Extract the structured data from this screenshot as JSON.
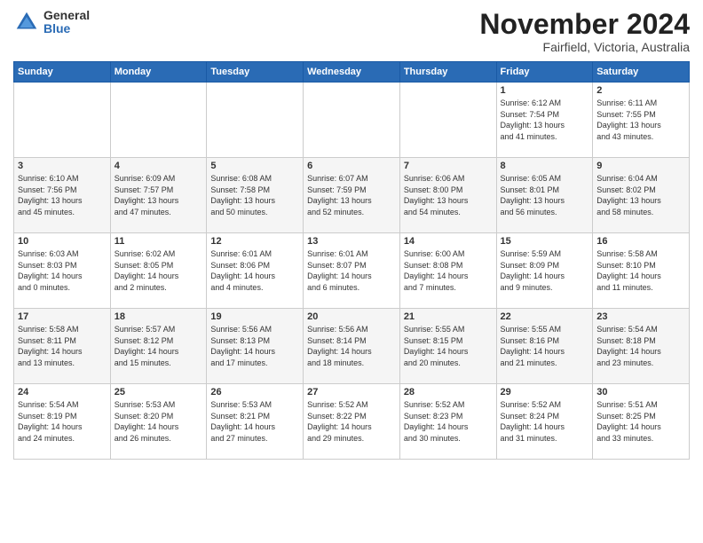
{
  "logo": {
    "general": "General",
    "blue": "Blue"
  },
  "title": "November 2024",
  "subtitle": "Fairfield, Victoria, Australia",
  "days_of_week": [
    "Sunday",
    "Monday",
    "Tuesday",
    "Wednesday",
    "Thursday",
    "Friday",
    "Saturday"
  ],
  "weeks": [
    [
      {
        "day": "",
        "info": ""
      },
      {
        "day": "",
        "info": ""
      },
      {
        "day": "",
        "info": ""
      },
      {
        "day": "",
        "info": ""
      },
      {
        "day": "",
        "info": ""
      },
      {
        "day": "1",
        "info": "Sunrise: 6:12 AM\nSunset: 7:54 PM\nDaylight: 13 hours\nand 41 minutes."
      },
      {
        "day": "2",
        "info": "Sunrise: 6:11 AM\nSunset: 7:55 PM\nDaylight: 13 hours\nand 43 minutes."
      }
    ],
    [
      {
        "day": "3",
        "info": "Sunrise: 6:10 AM\nSunset: 7:56 PM\nDaylight: 13 hours\nand 45 minutes."
      },
      {
        "day": "4",
        "info": "Sunrise: 6:09 AM\nSunset: 7:57 PM\nDaylight: 13 hours\nand 47 minutes."
      },
      {
        "day": "5",
        "info": "Sunrise: 6:08 AM\nSunset: 7:58 PM\nDaylight: 13 hours\nand 50 minutes."
      },
      {
        "day": "6",
        "info": "Sunrise: 6:07 AM\nSunset: 7:59 PM\nDaylight: 13 hours\nand 52 minutes."
      },
      {
        "day": "7",
        "info": "Sunrise: 6:06 AM\nSunset: 8:00 PM\nDaylight: 13 hours\nand 54 minutes."
      },
      {
        "day": "8",
        "info": "Sunrise: 6:05 AM\nSunset: 8:01 PM\nDaylight: 13 hours\nand 56 minutes."
      },
      {
        "day": "9",
        "info": "Sunrise: 6:04 AM\nSunset: 8:02 PM\nDaylight: 13 hours\nand 58 minutes."
      }
    ],
    [
      {
        "day": "10",
        "info": "Sunrise: 6:03 AM\nSunset: 8:03 PM\nDaylight: 14 hours\nand 0 minutes."
      },
      {
        "day": "11",
        "info": "Sunrise: 6:02 AM\nSunset: 8:05 PM\nDaylight: 14 hours\nand 2 minutes."
      },
      {
        "day": "12",
        "info": "Sunrise: 6:01 AM\nSunset: 8:06 PM\nDaylight: 14 hours\nand 4 minutes."
      },
      {
        "day": "13",
        "info": "Sunrise: 6:01 AM\nSunset: 8:07 PM\nDaylight: 14 hours\nand 6 minutes."
      },
      {
        "day": "14",
        "info": "Sunrise: 6:00 AM\nSunset: 8:08 PM\nDaylight: 14 hours\nand 7 minutes."
      },
      {
        "day": "15",
        "info": "Sunrise: 5:59 AM\nSunset: 8:09 PM\nDaylight: 14 hours\nand 9 minutes."
      },
      {
        "day": "16",
        "info": "Sunrise: 5:58 AM\nSunset: 8:10 PM\nDaylight: 14 hours\nand 11 minutes."
      }
    ],
    [
      {
        "day": "17",
        "info": "Sunrise: 5:58 AM\nSunset: 8:11 PM\nDaylight: 14 hours\nand 13 minutes."
      },
      {
        "day": "18",
        "info": "Sunrise: 5:57 AM\nSunset: 8:12 PM\nDaylight: 14 hours\nand 15 minutes."
      },
      {
        "day": "19",
        "info": "Sunrise: 5:56 AM\nSunset: 8:13 PM\nDaylight: 14 hours\nand 17 minutes."
      },
      {
        "day": "20",
        "info": "Sunrise: 5:56 AM\nSunset: 8:14 PM\nDaylight: 14 hours\nand 18 minutes."
      },
      {
        "day": "21",
        "info": "Sunrise: 5:55 AM\nSunset: 8:15 PM\nDaylight: 14 hours\nand 20 minutes."
      },
      {
        "day": "22",
        "info": "Sunrise: 5:55 AM\nSunset: 8:16 PM\nDaylight: 14 hours\nand 21 minutes."
      },
      {
        "day": "23",
        "info": "Sunrise: 5:54 AM\nSunset: 8:18 PM\nDaylight: 14 hours\nand 23 minutes."
      }
    ],
    [
      {
        "day": "24",
        "info": "Sunrise: 5:54 AM\nSunset: 8:19 PM\nDaylight: 14 hours\nand 24 minutes."
      },
      {
        "day": "25",
        "info": "Sunrise: 5:53 AM\nSunset: 8:20 PM\nDaylight: 14 hours\nand 26 minutes."
      },
      {
        "day": "26",
        "info": "Sunrise: 5:53 AM\nSunset: 8:21 PM\nDaylight: 14 hours\nand 27 minutes."
      },
      {
        "day": "27",
        "info": "Sunrise: 5:52 AM\nSunset: 8:22 PM\nDaylight: 14 hours\nand 29 minutes."
      },
      {
        "day": "28",
        "info": "Sunrise: 5:52 AM\nSunset: 8:23 PM\nDaylight: 14 hours\nand 30 minutes."
      },
      {
        "day": "29",
        "info": "Sunrise: 5:52 AM\nSunset: 8:24 PM\nDaylight: 14 hours\nand 31 minutes."
      },
      {
        "day": "30",
        "info": "Sunrise: 5:51 AM\nSunset: 8:25 PM\nDaylight: 14 hours\nand 33 minutes."
      }
    ]
  ]
}
